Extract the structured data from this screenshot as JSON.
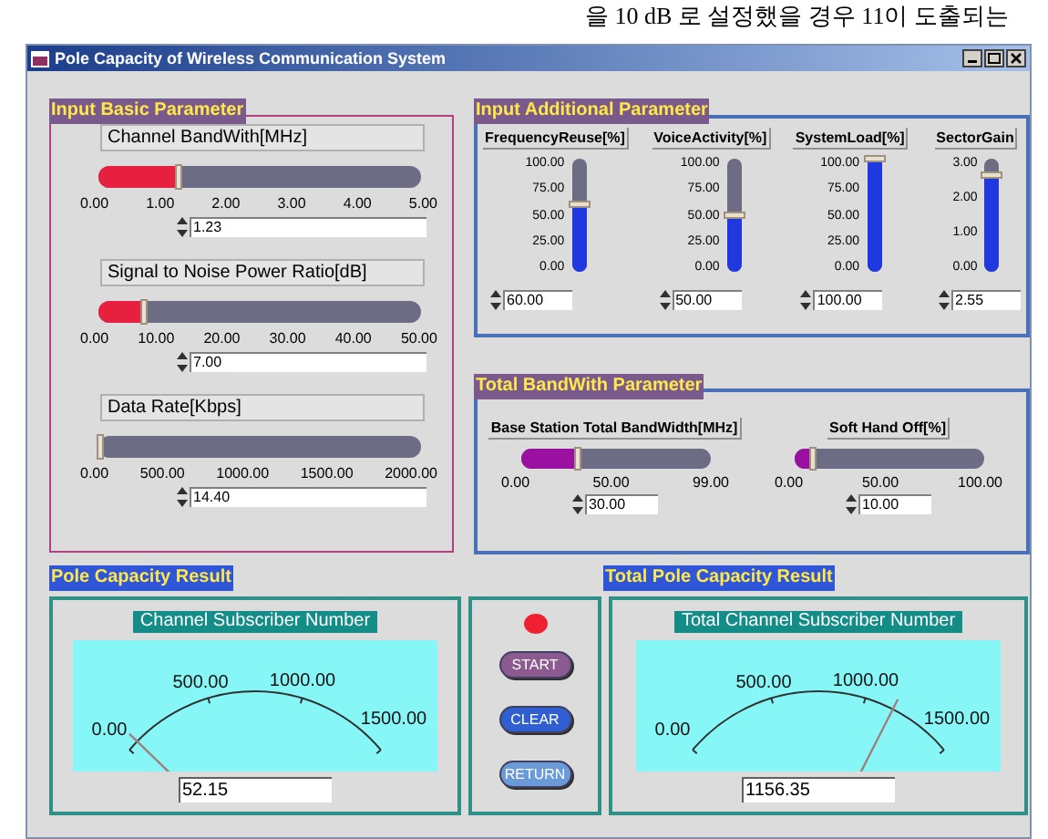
{
  "page_caption": "을 10 dB 로 설정했을 경우 11이 도출되는",
  "window": {
    "title": "Pole Capacity of Wireless Communication System"
  },
  "basic": {
    "label": "Input Basic Parameter",
    "sliders": [
      {
        "title": "Channel BandWith[MHz]",
        "level": 0.246,
        "ticks": [
          "0.00",
          "1.00",
          "2.00",
          "3.00",
          "4.00",
          "5.00"
        ],
        "value": "1.23"
      },
      {
        "title": "Signal to Noise Power Ratio[dB]",
        "level": 0.14,
        "ticks": [
          "0.00",
          "10.00",
          "20.00",
          "30.00",
          "40.00",
          "50.00"
        ],
        "value": "7.00"
      },
      {
        "title": "Data Rate[Kbps]",
        "level": 0.0072,
        "ticks": [
          "0.00",
          "500.00",
          "1000.00",
          "1500.00",
          "2000.00"
        ],
        "value": "14.40"
      }
    ]
  },
  "additional": {
    "label": "Input Additional Parameter",
    "sliders": [
      {
        "title": "FrequencyReuse[%]",
        "ticks": [
          "100.00",
          "75.00",
          "50.00",
          "25.00",
          "0.00"
        ],
        "level": 0.6,
        "value": "60.00"
      },
      {
        "title": "VoiceActivity[%]",
        "ticks": [
          "100.00",
          "75.00",
          "50.00",
          "25.00",
          "0.00"
        ],
        "level": 0.5,
        "value": "50.00"
      },
      {
        "title": "SystemLoad[%]",
        "ticks": [
          "100.00",
          "75.00",
          "50.00",
          "25.00",
          "0.00"
        ],
        "level": 1.0,
        "value": "100.00"
      },
      {
        "title": "SectorGain",
        "ticks": [
          "3.00",
          "2.00",
          "1.00",
          "0.00"
        ],
        "level": 0.85,
        "value": "2.55"
      }
    ]
  },
  "total_bandwidth": {
    "label": "Total BandWith Parameter",
    "sliders": [
      {
        "title": "Base Station Total BandWidth[MHz]",
        "level": 0.303,
        "ticks": [
          "0.00",
          "50.00",
          "99.00"
        ],
        "value": "30.00"
      },
      {
        "title": "Soft Hand Off[%]",
        "level": 0.1,
        "ticks": [
          "0.00",
          "50.00",
          "100.00"
        ],
        "value": "10.00"
      }
    ]
  },
  "results": [
    {
      "label": "Pole Capacity Result",
      "title": "Channel Subscriber Number",
      "scale": [
        "0.00",
        "500.00",
        "1000.00",
        "1500.00"
      ],
      "value": "52.15"
    },
    {
      "label": "Total Pole Capacity Result",
      "title": "Total Channel Subscriber Number",
      "scale": [
        "0.00",
        "500.00",
        "1000.00",
        "1500.00"
      ],
      "value": "1156.35"
    }
  ],
  "controls": {
    "indicator": {
      "on": true
    },
    "buttons": [
      {
        "label": "START",
        "color": "#8a5a90"
      },
      {
        "label": "CLEAR",
        "color": "#2f5fd0"
      },
      {
        "label": "RETURN",
        "color": "#6a9ad8"
      }
    ]
  }
}
